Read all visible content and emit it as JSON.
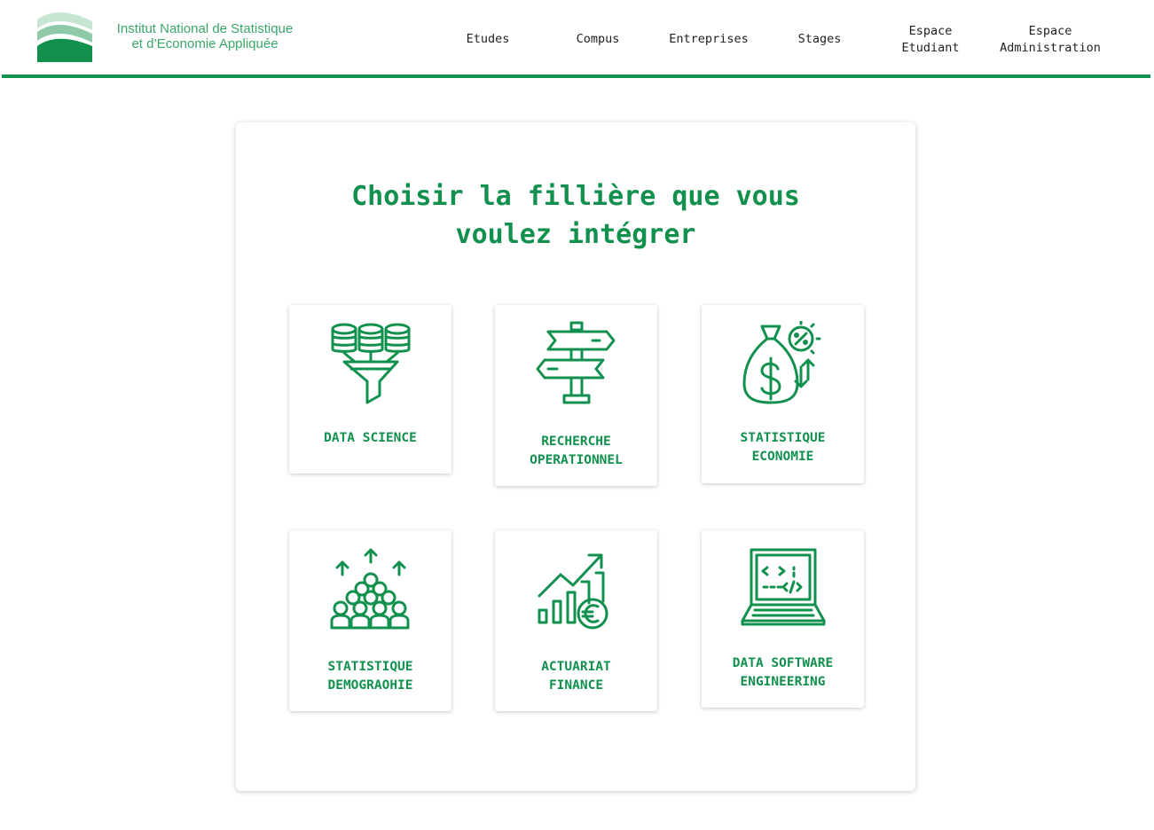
{
  "header": {
    "logo_line1": "Institut National de Statistique",
    "logo_line2": "et d’Economie Appliquée",
    "nav": [
      {
        "label": "Etudes"
      },
      {
        "label": "Compus"
      },
      {
        "label": "Entreprises"
      },
      {
        "label": "Stages"
      },
      {
        "label": "Espace\nEtudiant"
      },
      {
        "label": "Espace\nAdministration"
      }
    ]
  },
  "main": {
    "title": "Choisir la fillière que vous voulez intégrer",
    "cards": [
      {
        "label": "DATA SCIENCE",
        "icon": "database-funnel-icon"
      },
      {
        "label": "RECHERCHE\nOPERATIONNEL",
        "icon": "signpost-icon"
      },
      {
        "label": "STATISTIQUE\nECONOMIE",
        "icon": "money-bag-icon"
      },
      {
        "label": "STATISTIQUE\nDEMOGRAOHIE",
        "icon": "crowd-growth-icon"
      },
      {
        "label": "ACTUARIAT\nFINANCE",
        "icon": "euro-growth-chart-icon"
      },
      {
        "label": "DATA SOFTWARE\nENGINEERING",
        "icon": "code-laptop-icon"
      }
    ]
  },
  "colors": {
    "brand_green": "#12904e",
    "logo_light_green": "#9fd3b4"
  }
}
